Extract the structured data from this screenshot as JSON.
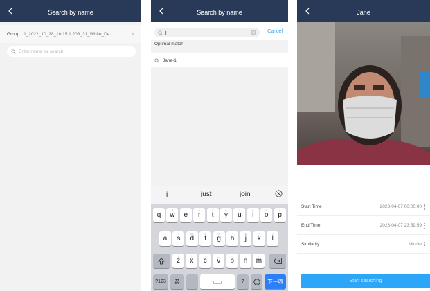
{
  "screen1": {
    "title": "Search by name",
    "group_label": "Group",
    "group_value": "1_2022_10_28_10.15.1.208_31_White_De...",
    "search_placeholder": "Enter name for search"
  },
  "screen2": {
    "title": "Search by name",
    "search_value": "j",
    "cancel_label": "Cancel",
    "section_title": "Optimal match",
    "results": [
      "Jane-1"
    ],
    "suggestions": [
      "j",
      "just",
      "join"
    ],
    "keyboard": {
      "row1": [
        [
          "q",
          "1"
        ],
        [
          "w",
          "2"
        ],
        [
          "e",
          "3"
        ],
        [
          "r",
          "4"
        ],
        [
          "t",
          "5"
        ],
        [
          "y",
          "6"
        ],
        [
          "u",
          "7"
        ],
        [
          "i",
          "8"
        ],
        [
          "o",
          "9"
        ],
        [
          "p",
          "0"
        ]
      ],
      "row2": [
        [
          "a",
          "~"
        ],
        [
          "s",
          "!"
        ],
        [
          "d",
          "@"
        ],
        [
          "f",
          "#"
        ],
        [
          "g",
          "%"
        ],
        [
          "h",
          "'"
        ],
        [
          "j",
          "&"
        ],
        [
          "k",
          "*"
        ],
        [
          "l",
          "?"
        ]
      ],
      "row3": [
        [
          "z",
          "("
        ],
        [
          "x",
          ")"
        ],
        [
          "c",
          "-"
        ],
        [
          "v",
          "_"
        ],
        [
          "b",
          ":"
        ],
        [
          "n",
          ";"
        ],
        [
          "m",
          "/"
        ]
      ],
      "num_key": "?123",
      "lang_key": "英",
      "comma_key": "，",
      "dot_key": "·",
      "question_key": "?",
      "enter_key": "下一项"
    }
  },
  "screen3": {
    "title": "Jane",
    "fields": [
      {
        "label": "Start Time",
        "value": "2023-04-07 00:00:00"
      },
      {
        "label": "End Time",
        "value": "2023-04-07 23:59:59"
      },
      {
        "label": "Similarity",
        "value": "Middle"
      }
    ],
    "start_button": "Start searching"
  },
  "colors": {
    "navbar": "#283a58",
    "accent": "#2d9cf0",
    "button": "#2ba6f8",
    "background": "#f2f2f2"
  }
}
